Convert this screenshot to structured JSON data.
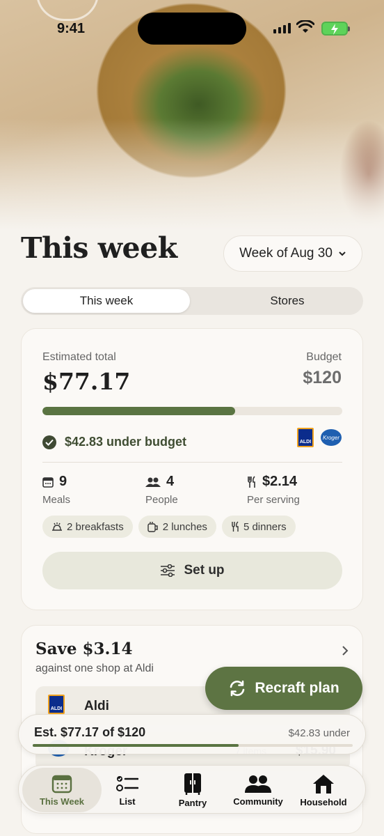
{
  "status": {
    "time": "9:41"
  },
  "header": {
    "title": "This week",
    "week_selector": "Week of Aug 30"
  },
  "segments": [
    {
      "label": "This week",
      "active": true
    },
    {
      "label": "Stores",
      "active": false
    }
  ],
  "summary": {
    "estimated_label": "Estimated total",
    "estimated_value": "$77.17",
    "budget_label": "Budget",
    "budget_value": "$120",
    "progress": 0.643,
    "under_budget": "$42.83 under budget",
    "stats": [
      {
        "icon": "calendar-icon",
        "value": "9",
        "label": "Meals"
      },
      {
        "icon": "people-icon",
        "value": "4",
        "label": "People"
      },
      {
        "icon": "fork-knife-icon",
        "value": "$2.14",
        "label": "Per serving"
      }
    ],
    "chips": [
      {
        "icon": "breakfast-icon",
        "label": "2 breakfasts"
      },
      {
        "icon": "lunch-icon",
        "label": "2 lunches"
      },
      {
        "icon": "dinner-icon",
        "label": "5 dinners"
      }
    ],
    "setup_label": "Set up"
  },
  "savings": {
    "title": "Save $3.14",
    "subtitle": "against one shop at Aldi",
    "stores": [
      {
        "name": "Aldi"
      },
      {
        "name": "Kroger",
        "items": "7 items",
        "price": "$15.90"
      }
    ]
  },
  "recraft_label": "Recraft plan",
  "est_pill": {
    "left": "Est. $77.17 of $120",
    "right": "$42.83 under",
    "progress": 0.643
  },
  "tabs": [
    {
      "label": "This Week",
      "active": true
    },
    {
      "label": "List"
    },
    {
      "label": "Pantry"
    },
    {
      "label": "Community"
    },
    {
      "label": "Household"
    }
  ],
  "colors": {
    "accent": "#5a7442",
    "background": "#f6f3ee"
  }
}
